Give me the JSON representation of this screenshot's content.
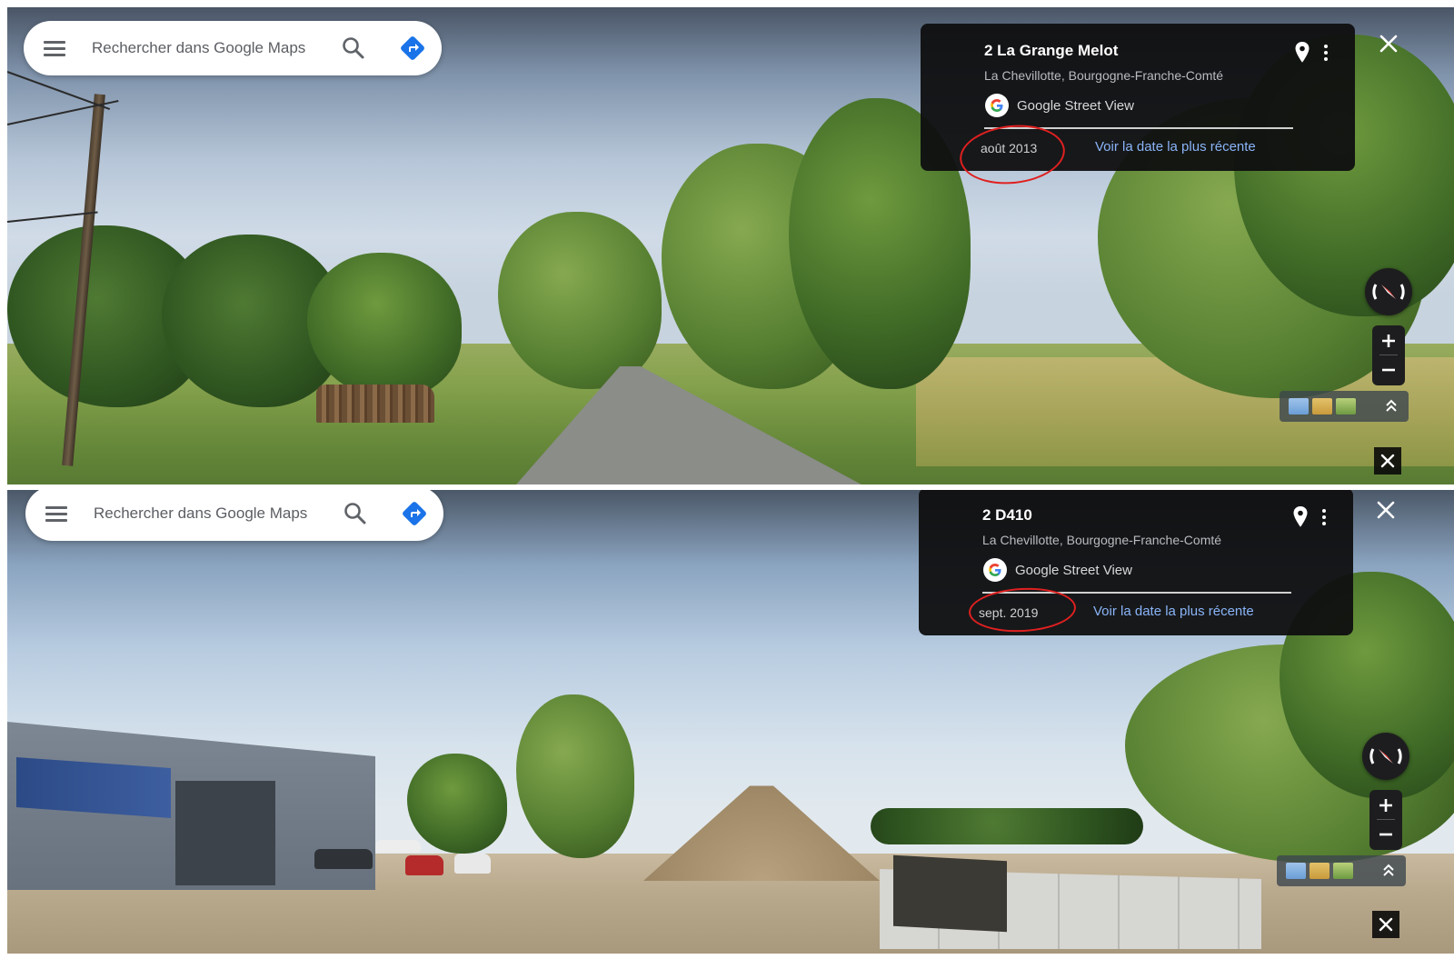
{
  "panels": [
    {
      "search": {
        "placeholder": "Rechercher dans Google Maps"
      },
      "card": {
        "title": "2 La Grange Melot",
        "subtitle": "La Chevillotte, Bourgogne-Franche-Comté",
        "source": "Google Street View",
        "date": "août 2013",
        "recent_link": "Voir la date la plus récente"
      },
      "zoom": {
        "in": "+",
        "out": "−"
      }
    },
    {
      "search": {
        "placeholder": "Rechercher dans Google Maps"
      },
      "card": {
        "title": "2 D410",
        "subtitle": "La Chevillotte, Bourgogne-Franche-Comté",
        "source": "Google Street View",
        "date": "sept. 2019",
        "recent_link": "Voir la date la plus récente"
      },
      "zoom": {
        "in": "+",
        "out": "−"
      }
    }
  ],
  "colors": {
    "annotation_ring": "#e02020",
    "link": "#8ab4f8",
    "directions": "#1a73e8",
    "card_bg": "#0f0f10"
  },
  "icons": [
    "menu-icon",
    "search-icon",
    "directions-icon",
    "pin-icon",
    "more-vert-icon",
    "google-g-icon",
    "close-icon",
    "compass-icon",
    "chevron-up-icon"
  ]
}
